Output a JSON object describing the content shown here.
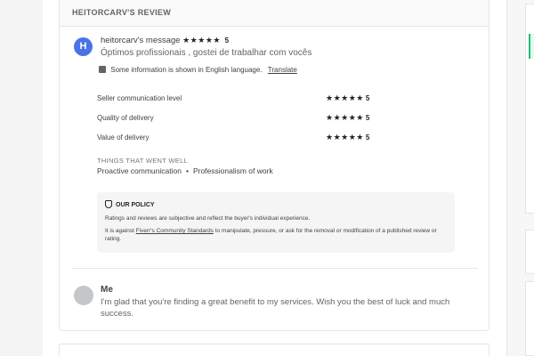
{
  "review": {
    "header": "HEITORCARV'S REVIEW",
    "avatar_letter": "H",
    "username": "heitorcarv's message",
    "stars": "★★★★★",
    "score": "5",
    "message": "Óptimos profissionais , gostei de trabalhar com vocês",
    "translate_note": "Some information is shown in English language.",
    "translate_link": "Translate",
    "ratings": [
      {
        "label": "Seller communication level",
        "stars": "★★★★★",
        "score": "5"
      },
      {
        "label": "Quality of delivery",
        "stars": "★★★★★",
        "score": "5"
      },
      {
        "label": "Value of delivery",
        "stars": "★★★★★",
        "score": "5"
      }
    ],
    "things_title": "THINGS THAT WENT WELL",
    "things": [
      "Proactive communication",
      "Professionalism of work"
    ],
    "things_sep": "•",
    "policy": {
      "title": "OUR POLICY",
      "line1": "Ratings and reviews are subjective and reflect the buyer's individual experience.",
      "line2_pre": "It is against ",
      "line2_link": "Fiverr's Community Standards",
      "line2_post": " to manipulate, pressure, or ask for the removal or modification of a published review or rating."
    }
  },
  "reply": {
    "name": "Me",
    "text": "I'm glad that you're finding a great benefit to my services. Wish you the best of luck and much success."
  },
  "colors": {
    "avatar": "#4a73e8",
    "accent_green": "#1dbf73",
    "policy_bg": "#f5f5f5"
  }
}
